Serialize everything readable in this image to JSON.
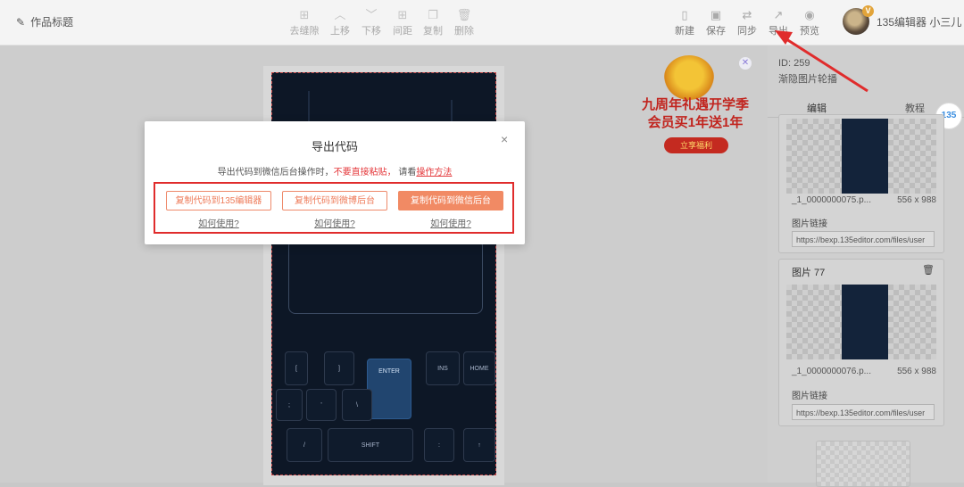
{
  "header": {
    "doc_title": "作品标题",
    "tools": [
      {
        "label": "去缝隙",
        "icon": "grid-icon"
      },
      {
        "label": "上移",
        "icon": "chevron-up-icon"
      },
      {
        "label": "下移",
        "icon": "chevron-down-icon"
      },
      {
        "label": "间距",
        "icon": "spacing-icon"
      },
      {
        "label": "复制",
        "icon": "copy-icon"
      },
      {
        "label": "删除",
        "icon": "trash-icon"
      }
    ],
    "actions": [
      {
        "label": "新建",
        "icon": "file-new-icon"
      },
      {
        "label": "保存",
        "icon": "save-icon"
      },
      {
        "label": "同步",
        "icon": "sync-icon"
      },
      {
        "label": "导出",
        "icon": "export-icon"
      },
      {
        "label": "预览",
        "icon": "eye-icon"
      }
    ],
    "user_name": "135编辑器 小三儿",
    "user_badge": "V"
  },
  "canvas": {
    "keys": [
      "[",
      "]",
      "ENTER",
      "INS",
      "HOME",
      ";",
      "'",
      "\\",
      "/",
      "SHIFT",
      ":"
    ]
  },
  "promo": {
    "line1": "九周年礼遇开学季",
    "line2": "会员买1年送1年",
    "button": "立享福利"
  },
  "right_panel": {
    "id_text": "ID: 259",
    "template_name": "渐隐图片轮播",
    "tabs": [
      "编辑",
      "教程"
    ],
    "logo": "135",
    "cards": [
      {
        "title": "",
        "file_name": "_1_0000000075.p...",
        "file_size": "556 x 988",
        "link_label": "图片链接",
        "url": "https://bexp.135editor.com/files/user"
      },
      {
        "title": "图片 77",
        "file_name": "_1_0000000076.p...",
        "file_size": "556 x 988",
        "link_label": "图片链接",
        "url": "https://bexp.135editor.com/files/user"
      }
    ]
  },
  "modal": {
    "title": "导出代码",
    "desc_prefix": "导出代码到微信后台操作时，",
    "desc_warn": "不要直接粘贴，",
    "desc_mid": " 请看",
    "desc_link": "操作方法",
    "close": "×",
    "buttons": [
      {
        "label": "复制代码到135编辑器",
        "howto": "如何使用?"
      },
      {
        "label": "复制代码到微博后台",
        "howto": "如何使用?"
      },
      {
        "label": "复制代码到微信后台",
        "howto": "如何使用?"
      }
    ]
  },
  "colors": {
    "accent": "#f18a64",
    "warn": "#e4393c",
    "highlight": "#e02c2c"
  }
}
